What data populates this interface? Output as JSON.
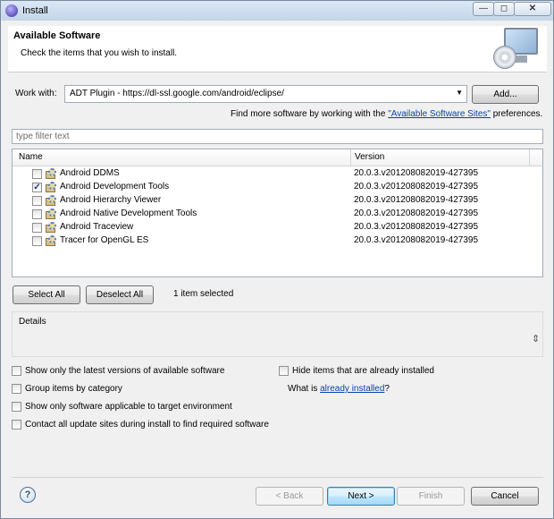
{
  "window": {
    "title": "Install",
    "minimize": "—",
    "restore": "◻",
    "close": "✕"
  },
  "header": {
    "title": "Available Software",
    "message": "Check the items that you wish to install."
  },
  "work_with": {
    "label": "Work with:",
    "value": "ADT Plugin - https://dl-ssl.google.com/android/eclipse/",
    "add_button": "Add...",
    "hint_prefix": "Find more software by working with the ",
    "hint_link": "\"Available Software Sites\"",
    "hint_suffix": " preferences."
  },
  "filter": {
    "placeholder": "type filter text"
  },
  "table": {
    "columns": [
      "Name",
      "Version"
    ],
    "rows": [
      {
        "name": "Android DDMS",
        "version": "20.0.3.v201208082019-427395",
        "checked": false
      },
      {
        "name": "Android Development Tools",
        "version": "20.0.3.v201208082019-427395",
        "checked": true
      },
      {
        "name": "Android Hierarchy Viewer",
        "version": "20.0.3.v201208082019-427395",
        "checked": false
      },
      {
        "name": "Android Native Development Tools",
        "version": "20.0.3.v201208082019-427395",
        "checked": false
      },
      {
        "name": "Android Traceview",
        "version": "20.0.3.v201208082019-427395",
        "checked": false
      },
      {
        "name": "Tracer for OpenGL ES",
        "version": "20.0.3.v201208082019-427395",
        "checked": false
      }
    ]
  },
  "selection": {
    "select_all": "Select All",
    "deselect_all": "Deselect All",
    "status": "1 item selected"
  },
  "details": {
    "label": "Details",
    "scroll_glyph": "⇕"
  },
  "options": {
    "latest_versions": {
      "label": "Show only the latest versions of available software",
      "checked": false
    },
    "hide_installed": {
      "label": "Hide items that are already installed",
      "checked": false
    },
    "group_by_category": {
      "label": "Group items by category",
      "checked": false
    },
    "what_is_prefix": "What is ",
    "what_is_link": "already installed",
    "what_is_suffix": "?",
    "target_env": {
      "label": "Show only software applicable to target environment",
      "checked": false
    },
    "contact_sites": {
      "label": "Contact all update sites during install to find required software",
      "checked": false
    }
  },
  "footer": {
    "help": "?",
    "back": "< Back",
    "next": "Next >",
    "finish": "Finish",
    "cancel": "Cancel"
  }
}
